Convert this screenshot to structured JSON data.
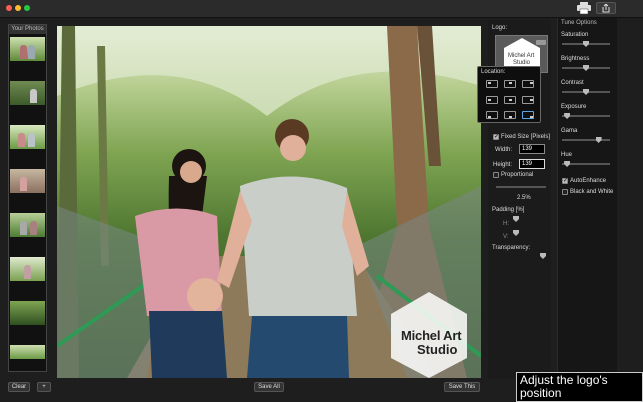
{
  "window": {
    "controls": [
      "close",
      "minimize",
      "zoom"
    ],
    "print_icon": "printer-icon",
    "share_icon": "share-icon"
  },
  "sidebar": {
    "title": "Your Photos",
    "thumbnail_count": 8
  },
  "photo": {
    "watermark_line1": "Michel Art",
    "watermark_line2": "Studio"
  },
  "logo_panel": {
    "logo_label": "Logo:",
    "logo_preview_line1": "Michel Art",
    "logo_preview_line2": "Studio",
    "location_label": "Location:",
    "location_selected": "bottom-right",
    "fixed_size_label": "Fixed Size [Pixels]",
    "fixed_size_checked": true,
    "width_label": "Width:",
    "width_value": "139",
    "height_label": "Height:",
    "height_value": "139",
    "proportional_label": "Proportional",
    "proportional_checked": false,
    "scale_value": "2.5%",
    "padding_label": "Padding [%]",
    "padding_h_label": "H:",
    "padding_v_label": "V:",
    "transparency_label": "Transparency:"
  },
  "tune": {
    "title": "Tune Options",
    "sliders": [
      {
        "label": "Saturation",
        "level": 0.5
      },
      {
        "label": "Brightness",
        "level": 0.5
      },
      {
        "label": "Contrast",
        "level": 0.5
      },
      {
        "label": "Exposure",
        "level": 0.05
      },
      {
        "label": "Gama",
        "level": 0.8
      },
      {
        "label": "Hue",
        "level": 0.05
      }
    ],
    "auto_enhance_label": "AutoEnhance",
    "auto_enhance_checked": true,
    "black_white_label": "Black and White",
    "black_white_checked": false
  },
  "bottom_bar": {
    "clear_label": "Clear",
    "add_label": "+",
    "save_all_label": "Save All",
    "save_this_label": "Save This"
  },
  "tooltip": {
    "text": "Adjust the logo's position"
  },
  "colors": {
    "background": "#1e1e1e",
    "accent": "#5aa6e8"
  }
}
